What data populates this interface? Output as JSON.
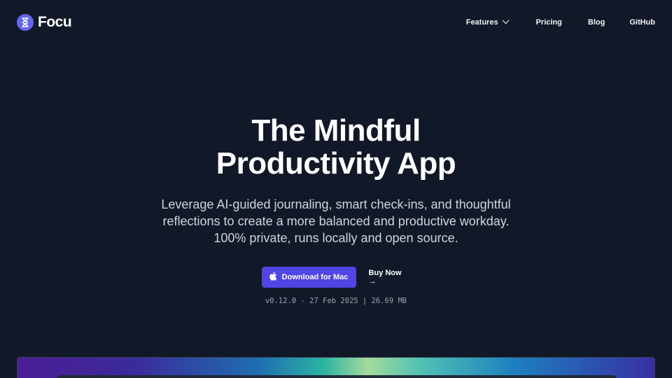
{
  "brand": {
    "name": "Focu",
    "accent": "#6366f1"
  },
  "nav": {
    "items": [
      {
        "label": "Features",
        "has_dropdown": true
      },
      {
        "label": "Pricing"
      },
      {
        "label": "Blog"
      },
      {
        "label": "GitHub"
      }
    ]
  },
  "hero": {
    "title_line1": "The Mindful",
    "title_line2": "Productivity App",
    "subtitle_line1": "Leverage AI-guided journaling, smart check-ins, and thoughtful",
    "subtitle_line2": "reflections to create a more balanced and productive workday.",
    "subtitle_line3": "100% private, runs locally and open source."
  },
  "cta": {
    "download_label": "Download for Mac",
    "download_icon": "apple-icon",
    "buy_label": "Buy Now →"
  },
  "release": {
    "version": "v0.12.0",
    "date": "27 Feb 2025",
    "size": "26.69 MB",
    "text": "v0.12.0 - 27 Feb 2025 | 26.69 MB"
  },
  "colors": {
    "background": "#111827",
    "primary_button": "#4f46e5",
    "text_muted": "#9ca3af"
  }
}
